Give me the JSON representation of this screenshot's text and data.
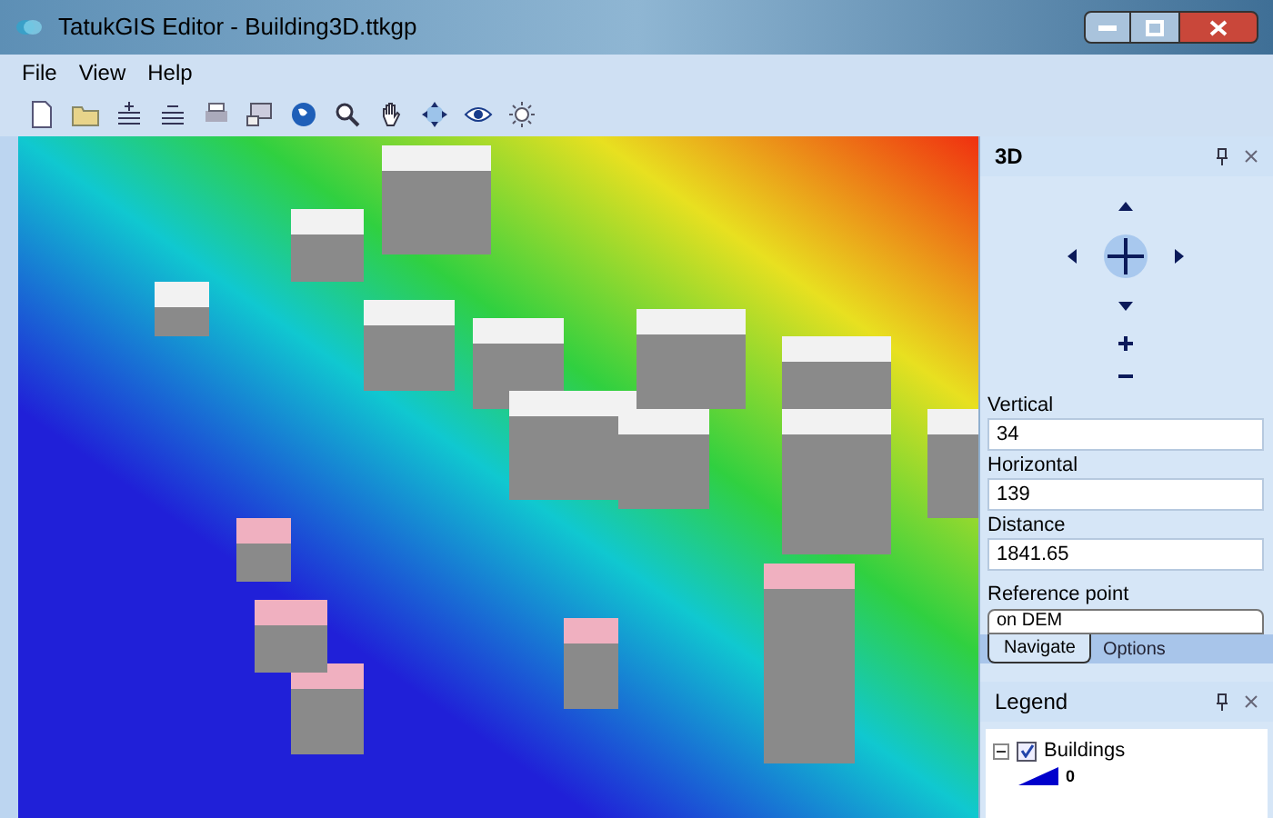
{
  "window": {
    "title": "TatukGIS Editor - Building3D.ttkgp"
  },
  "menu": [
    {
      "label": "File"
    },
    {
      "label": "View"
    },
    {
      "label": "Help"
    }
  ],
  "panel_3d": {
    "title": "3D",
    "fields": [
      {
        "label": "Vertical",
        "value": "34"
      },
      {
        "label": "Horizontal",
        "value": "139"
      },
      {
        "label": "Distance",
        "value": "1841.65"
      }
    ],
    "reference_point": {
      "label": "Reference point",
      "value": "on DEM"
    },
    "tabs": [
      {
        "label": "Navigate",
        "selected": true
      },
      {
        "label": "Options",
        "selected": false
      }
    ]
  },
  "legend": {
    "title": "Legend",
    "layers": [
      {
        "name": "Buildings",
        "checked": true,
        "expanded": true,
        "entries": [
          {
            "label": "0",
            "color": "#0000cc"
          }
        ]
      }
    ]
  }
}
